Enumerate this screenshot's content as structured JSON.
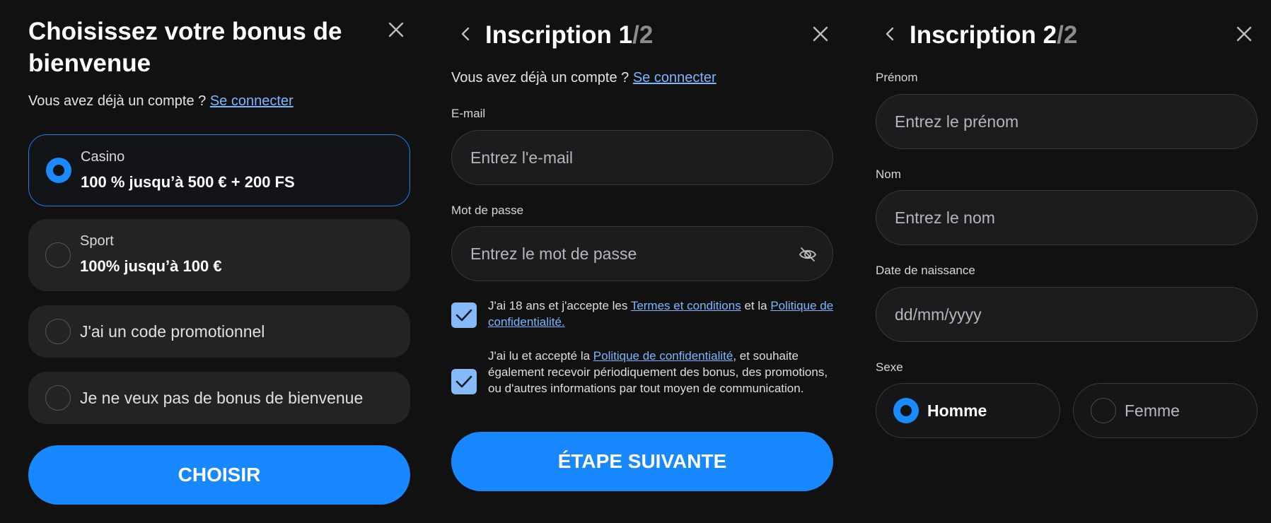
{
  "bonus_panel": {
    "title": "Choisissez votre bonus de bienvenue",
    "account_prompt": "Vous avez déjà un compte ?",
    "login_link": "Se connecter",
    "options": [
      {
        "label": "Casino",
        "value": "100 % jusqu’à 500 € + 200 FS",
        "selected": true
      },
      {
        "label": "Sport",
        "value": "100% jusqu’à 100 €",
        "selected": false
      },
      {
        "text": "J'ai un code promotionnel",
        "selected": false
      },
      {
        "text": "Je ne veux pas de bonus de bienvenue",
        "selected": false
      }
    ],
    "choose_button": "CHOISIR"
  },
  "step1": {
    "title_main": "Inscription 1",
    "title_total": "/2",
    "account_prompt": "Vous avez déjà un compte ?",
    "login_link": "Se connecter",
    "email_label": "E-mail",
    "email_placeholder": "Entrez l'e-mail",
    "password_label": "Mot de passe",
    "password_placeholder": "Entrez le mot de passe",
    "terms": {
      "checked": true,
      "text_before": "J'ai 18 ans et j'accepte les ",
      "link_terms": "Termes et conditions",
      "text_middle": " et la ",
      "link_privacy": "Politique de confidentialité."
    },
    "marketing": {
      "checked": true,
      "text_before": "J'ai lu et accepté la ",
      "link_privacy": "Politique de confidentialité",
      "text_after": ", et souhaite également recevoir périodiquement des bonus, des promotions, ou d'autres informations par tout moyen de communication."
    },
    "next_button": "ÉTAPE SUIVANTE"
  },
  "step2": {
    "title_main": "Inscription 2",
    "title_total": "/2",
    "firstname_label": "Prénom",
    "firstname_placeholder": "Entrez le prénom",
    "lastname_label": "Nom",
    "lastname_placeholder": "Entrez le nom",
    "birthdate_label": "Date de naissance",
    "birthdate_placeholder": "dd/mm/yyyy",
    "sex_label": "Sexe",
    "sex_options": [
      {
        "label": "Homme",
        "selected": true
      },
      {
        "label": "Femme",
        "selected": false
      }
    ]
  },
  "icons": {
    "close": "close-icon",
    "back": "chevron-left-icon",
    "eye": "eye-off-icon",
    "check": "checkmark-icon"
  },
  "colors": {
    "background": "#111112",
    "accent": "#1788ff",
    "link": "#7cb6ff",
    "checkbox": "#86b9f7"
  }
}
